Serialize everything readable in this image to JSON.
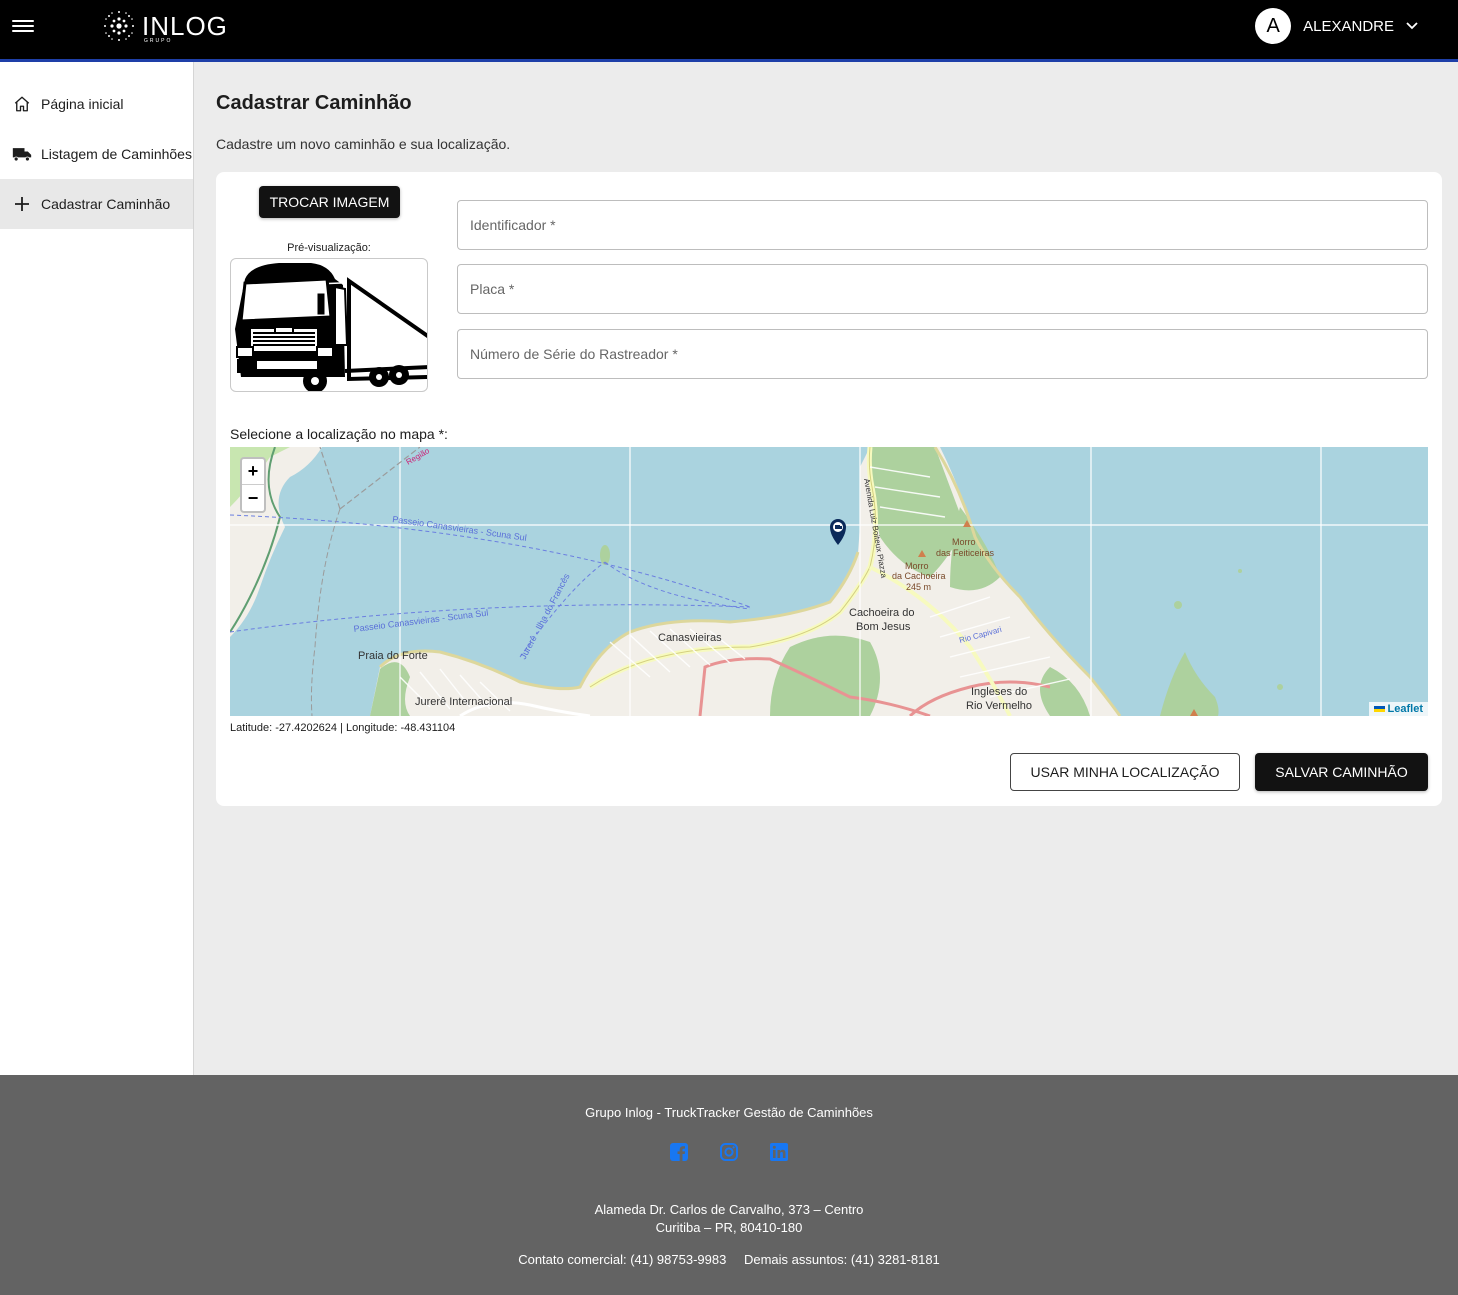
{
  "header": {
    "brand": "INLOG",
    "brand_sub": "GRUPO",
    "user_initial": "A",
    "user_name": "ALEXANDRE"
  },
  "sidebar": {
    "items": [
      {
        "label": "Página inicial",
        "icon": "home-icon"
      },
      {
        "label": "Listagem de Caminhões",
        "icon": "truck-icon"
      },
      {
        "label": "Cadastrar Caminhão",
        "icon": "plus-icon",
        "active": true
      }
    ]
  },
  "main": {
    "title": "Cadastrar Caminhão",
    "subtitle": "Cadastre um novo caminhão e sua localização.",
    "change_image_label": "TROCAR IMAGEM",
    "preview_label": "Pré-visualização:",
    "fields": {
      "identificador_placeholder": "Identificador *",
      "placa_placeholder": "Placa *",
      "serie_placeholder": "Número de Série do Rastreador *"
    },
    "map_label": "Selecione a localização no mapa *:",
    "map": {
      "zoom_in": "+",
      "zoom_out": "−",
      "attribution": "Leaflet",
      "place_labels": [
        "Canasvieiras",
        "Praia do Forte",
        "Jurerê Internacional",
        "Cachoeira do",
        "Bom Jesus",
        "Morro",
        "das Feiticeiras",
        "Morro",
        "da Cachoeira",
        "245 m",
        "Ingleses do",
        "Rio Vermelho",
        "Passeio Canasvieiras - Scuna Sul",
        "Passeio Canasvieiras - Scuna Sul",
        "Jurerê - Ilha do Francês",
        "Avenida Luiz Boiteux Piazza",
        "Rio Capivari",
        "Região"
      ]
    },
    "coords_text": "Latitude: -27.4202624 | Longitude: -48.431104",
    "use_location_label": "USAR MINHA LOCALIZAÇÃO",
    "save_label": "SALVAR CAMINHÃO"
  },
  "footer": {
    "title": "Grupo Inlog - TruckTracker Gestão de Caminhões",
    "socials": [
      "facebook-icon",
      "instagram-icon",
      "linkedin-icon"
    ],
    "address_line1": "Alameda Dr. Carlos de Carvalho, 373 – Centro",
    "address_line2": "Curitiba – PR, 80410-180",
    "contact_commercial": "Contato comercial: (41) 98753-9983",
    "contact_other": "Demais assuntos: (41) 3281-8181"
  },
  "colors": {
    "header_bg": "#000000",
    "header_accent": "#1e3fa8",
    "footer_bg": "#636363",
    "social_blue": "#1877f2",
    "map_water": "#aad3df",
    "map_land": "#f2efe9"
  }
}
